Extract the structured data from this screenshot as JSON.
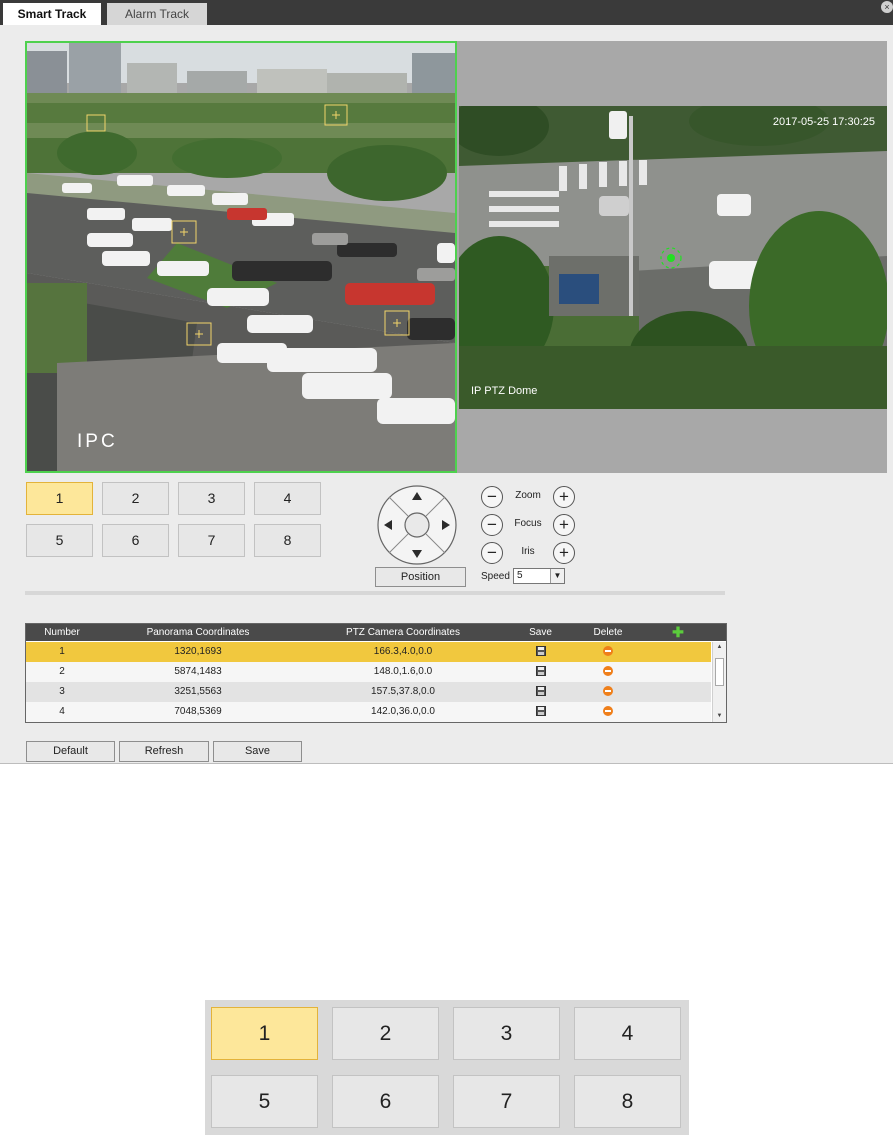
{
  "tabs": [
    {
      "label": "Smart Track",
      "active": true
    },
    {
      "label": "Alarm Track",
      "active": false
    }
  ],
  "close_icon_glyph": "×",
  "video": {
    "ipc_label": "IPC",
    "ptz_label": "IP PTZ Dome",
    "ptz_timestamp": "2017-05-25 17:30:25"
  },
  "presets": {
    "buttons": [
      "1",
      "2",
      "3",
      "4",
      "5",
      "6",
      "7",
      "8"
    ],
    "selected": "1"
  },
  "ptz_controls": {
    "zoom_label": "Zoom",
    "focus_label": "Focus",
    "iris_label": "Iris",
    "minus_glyph": "−",
    "plus_glyph": "+",
    "position_label": "Position",
    "speed_label": "Speed",
    "speed_value": "5"
  },
  "table": {
    "headers": {
      "number": "Number",
      "panorama": "Panorama Coordinates",
      "ptz": "PTZ Camera Coordinates",
      "save": "Save",
      "delete": "Delete",
      "add": "✚"
    },
    "rows": [
      {
        "number": "1",
        "panorama": "1320,1693",
        "ptz": "166.3,4.0,0.0",
        "selected": true
      },
      {
        "number": "2",
        "panorama": "5874,1483",
        "ptz": "148.0,1.6,0.0",
        "selected": false
      },
      {
        "number": "3",
        "panorama": "3251,5563",
        "ptz": "157.5,37.8,0.0",
        "selected": false
      },
      {
        "number": "4",
        "panorama": "7048,5369",
        "ptz": "142.0,36.0,0.0",
        "selected": false
      }
    ]
  },
  "buttons": {
    "default": "Default",
    "refresh": "Refresh",
    "save": "Save"
  },
  "colors": {
    "selected_preset": "#fde79a",
    "selected_row": "#f1c83e",
    "ipc_border": "#4ed14e",
    "tracking_target": "#22e022"
  }
}
